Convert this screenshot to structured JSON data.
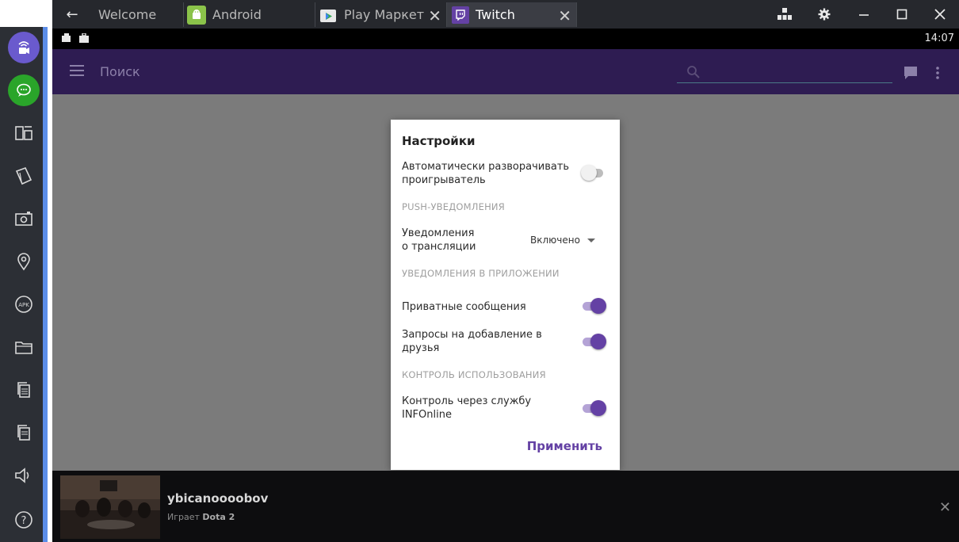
{
  "tabs": [
    {
      "label": "Welcome",
      "icon": "none",
      "active": false
    },
    {
      "label": "Android",
      "icon": "android-icon",
      "active": false
    },
    {
      "label": "Play Маркет",
      "icon": "play-store-icon",
      "active": false,
      "closable": true
    },
    {
      "label": "Twitch",
      "icon": "twitch-icon",
      "active": true,
      "closable": true
    }
  ],
  "window_controls": [
    "apps-grid-icon",
    "gear-icon",
    "minimize-icon",
    "maximize-icon",
    "close-icon"
  ],
  "status_bar": {
    "time": "14:07"
  },
  "app_bar": {
    "title": "Поиск"
  },
  "dialog": {
    "title": "Настройки",
    "auto_expand": {
      "label": "Автоматически разворачивать проигрыватель",
      "on": false
    },
    "section_push": "PUSH-УВЕДОМЛЕНИЯ",
    "stream_notifications": {
      "label_line1": "Уведомления",
      "label_line2": "о трансляции",
      "value": "Включено"
    },
    "section_in_app": "УВЕДОМЛЕНИЯ В ПРИЛОЖЕНИИ",
    "private_messages": {
      "label": "Приватные сообщения",
      "on": true
    },
    "friend_requests": {
      "label": "Запросы на добавление в друзья",
      "on": true
    },
    "section_usage": "КОНТРОЛЬ ИСПОЛЬЗОВАНИЯ",
    "infonline": {
      "label_line1": "Контроль через службу",
      "label_line2": "INFOnline",
      "on": true
    },
    "apply": "Применить"
  },
  "player": {
    "channel": "ybicanoooobov",
    "playing_prefix": "Играет",
    "game": "Dota 2"
  },
  "colors": {
    "accent": "#6441a4",
    "app_bar": "#2e1c52",
    "sidebar_edge": "#5b8de8"
  }
}
